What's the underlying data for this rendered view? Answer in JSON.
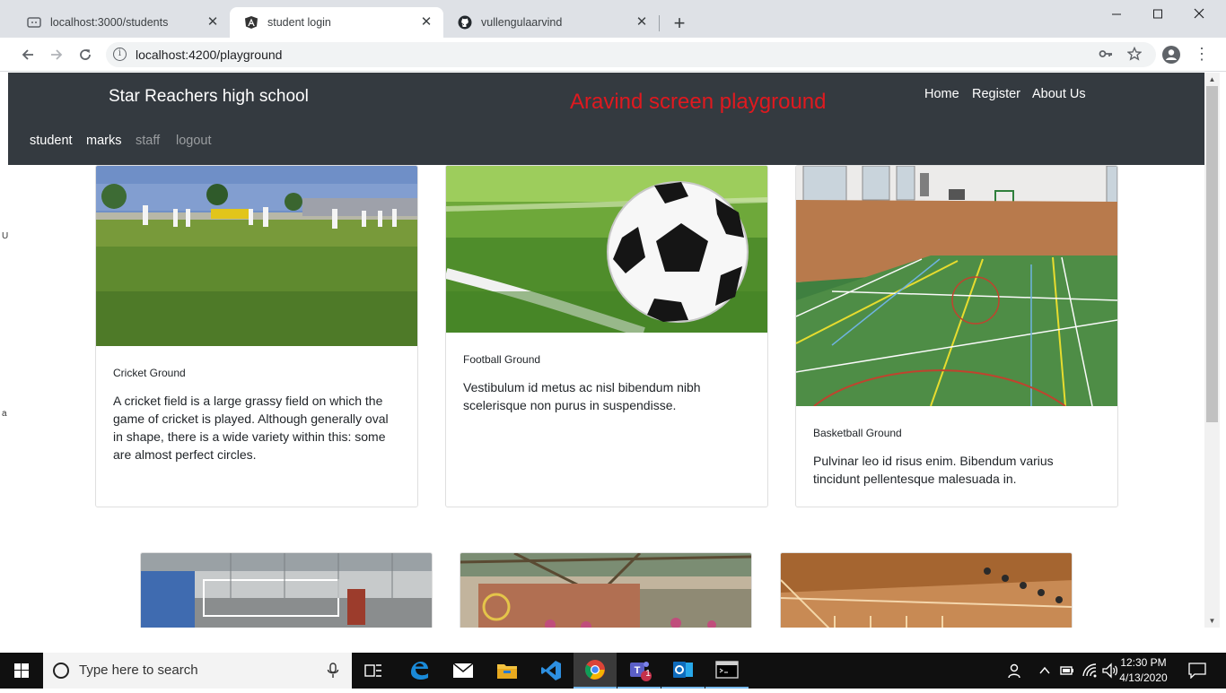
{
  "browser": {
    "tabs": [
      {
        "title": "localhost:3000/students"
      },
      {
        "title": "student login"
      },
      {
        "title": "vullengulaarvind"
      }
    ],
    "url": "localhost:4200/playground",
    "new_tab_symbol": "+"
  },
  "site": {
    "brand": "Star Reachers high school",
    "page_title": "Aravind screen playground",
    "page_title_color": "#e0191f",
    "top_links": [
      {
        "label": "Home"
      },
      {
        "label": "Register"
      },
      {
        "label": "About Us"
      }
    ],
    "sub_links": [
      {
        "label": "student",
        "active": true
      },
      {
        "label": "marks",
        "active": true
      },
      {
        "label": "staff",
        "active": false
      },
      {
        "label": "logout",
        "active": false
      }
    ],
    "cards": [
      {
        "title": "Cricket Ground",
        "text": "A cricket field is a large grassy field on which the game of cricket is played. Although generally oval in shape, there is a wide variety within this: some are almost perfect circles.",
        "image": "cricket-field-photo"
      },
      {
        "title": "Football Ground",
        "text": "Vestibulum id metus ac nisl bibendum nibh scelerisque non purus in suspendisse.",
        "image": "soccer-ball-photo"
      },
      {
        "title": "Basketball Ground",
        "text": "Pulvinar leo id risus enim. Bibendum varius tincidunt pellentesque malesuada in.",
        "image": "indoor-court-photo"
      }
    ],
    "second_row_images": [
      "indoor-hall-photo",
      "playground-photo",
      "wooden-hall-photo"
    ]
  },
  "taskbar": {
    "search_placeholder": "Type here to search",
    "time": "12:30 PM",
    "date": "4/13/2020",
    "teams_badge": "1"
  },
  "colors": {
    "navbar": "#343a40",
    "tabstrip": "#dee1e6"
  }
}
